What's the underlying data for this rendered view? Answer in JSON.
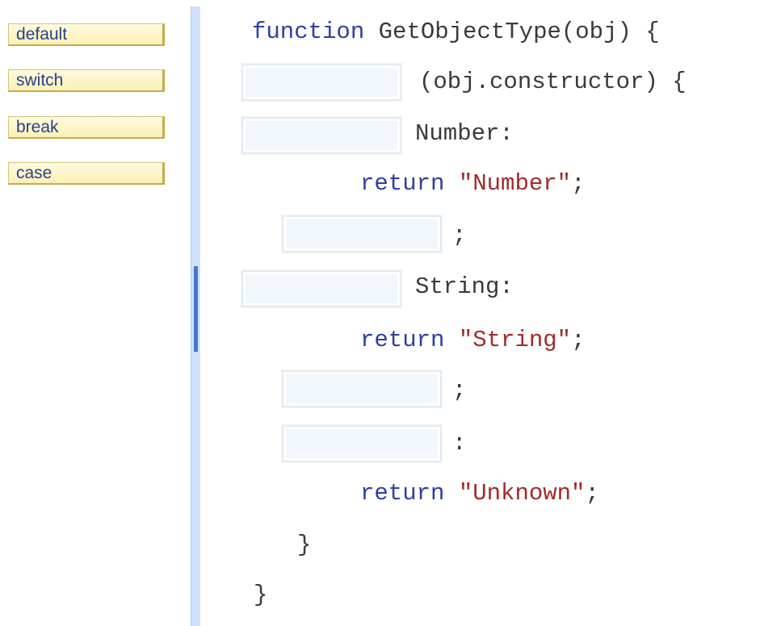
{
  "palette": {
    "tiles": [
      "default",
      "switch",
      "break",
      "case"
    ]
  },
  "code": {
    "func_keyword": "function",
    "func_signature": " GetObjectType(obj) {",
    "switch_tail": "(obj.constructor) {",
    "case1_tail": "Number:",
    "return_keyword": "return",
    "return_number": "\"Number\"",
    "return_string": "\"String\"",
    "return_unknown": "\"Unknown\"",
    "semicolon": ";",
    "case2_tail": "String:",
    "default_colon": ":",
    "inner_close": "}",
    "outer_close": "}"
  }
}
